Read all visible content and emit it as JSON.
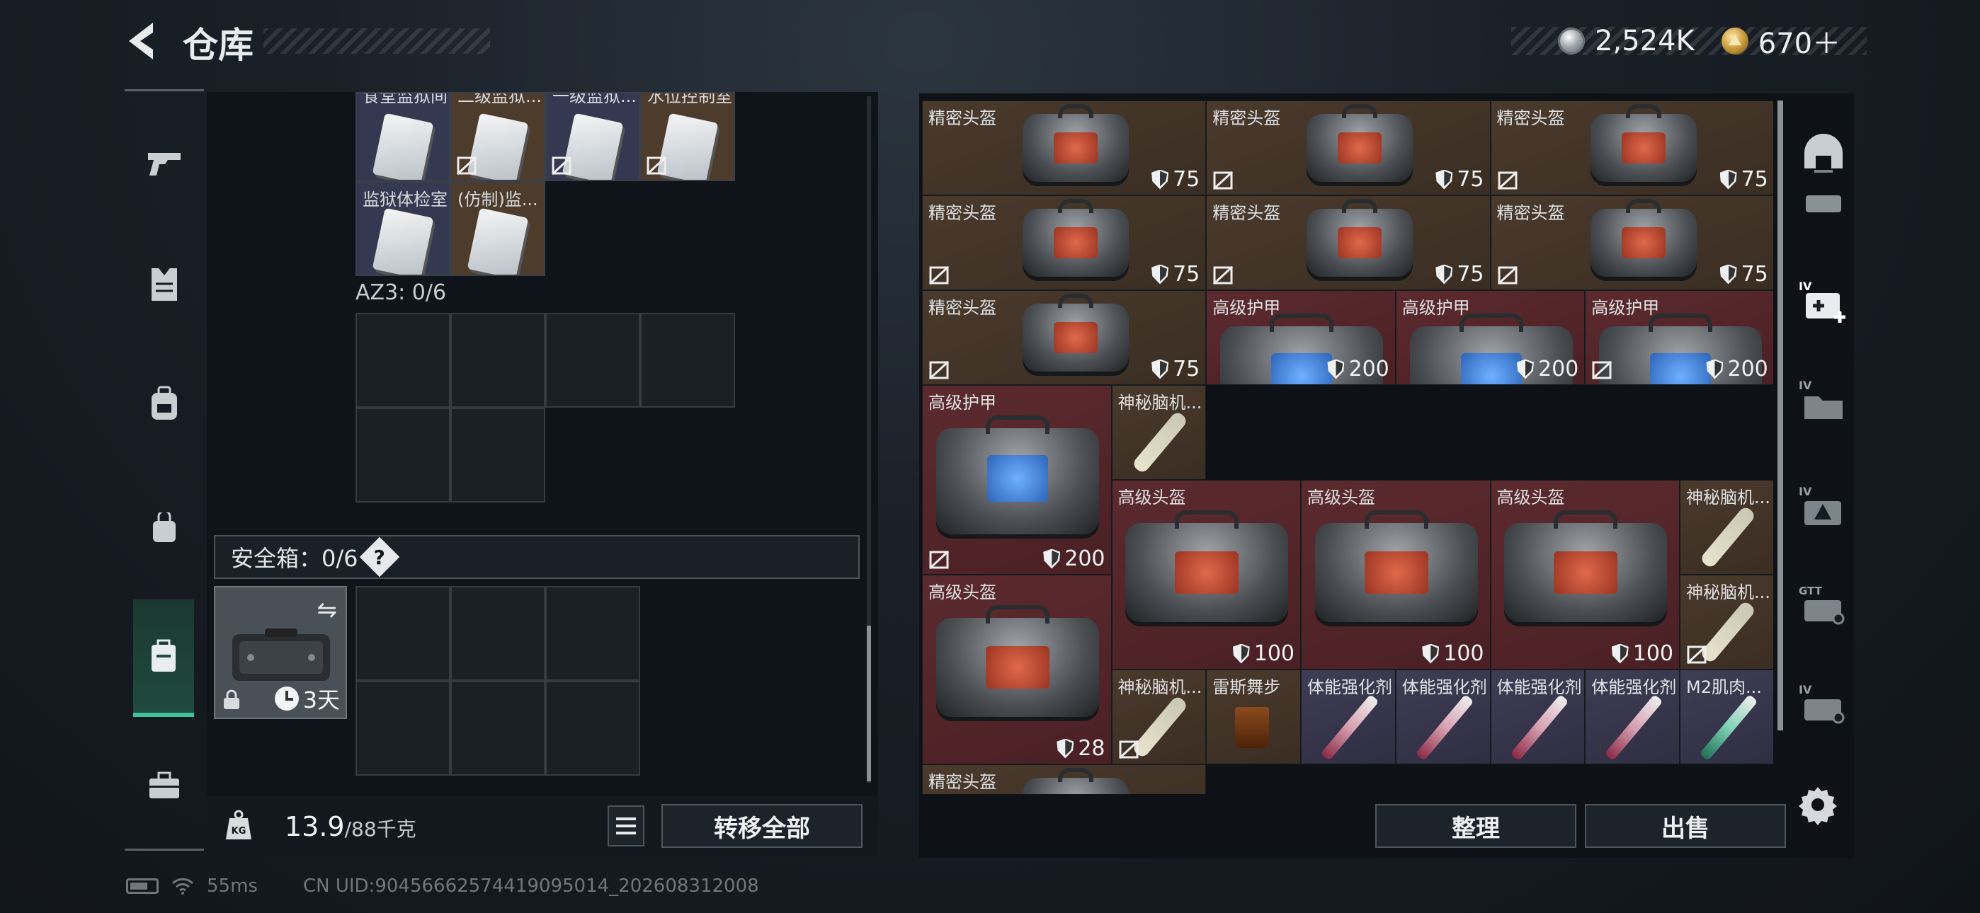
{
  "header": {
    "title": "仓库",
    "currency_silver": "2,524K",
    "currency_gold": "670＋"
  },
  "sidebar": {
    "items": [
      "weapons",
      "armor",
      "backpack",
      "bag",
      "safebox",
      "briefcase"
    ],
    "active": "safebox"
  },
  "storage": {
    "cut_labels": [
      "食堂监狱间",
      "二级监狱...",
      "一级监狱...",
      "水位控制室"
    ],
    "keycards_row2": [
      "监狱体检室",
      "(仿制)监..."
    ],
    "az3_label": "AZ3: 0/6",
    "safebox_label": "安全箱：0/6",
    "safebox_help": "?",
    "safebox_timer": "3天",
    "weight_value": "13.9",
    "weight_unit": "/88千克",
    "transfer_all": "转移全部"
  },
  "inventory": {
    "items": [
      {
        "name": "精密头盔",
        "value": "75"
      },
      {
        "name": "精密头盔",
        "value": "75"
      },
      {
        "name": "精密头盔",
        "value": "75"
      },
      {
        "name": "精密头盔",
        "value": "75"
      },
      {
        "name": "精密头盔",
        "value": "75"
      },
      {
        "name": "精密头盔",
        "value": "75"
      },
      {
        "name": "精密头盔",
        "value": "75"
      },
      {
        "name": "高级护甲",
        "value": "200"
      },
      {
        "name": "高级护甲",
        "value": "200"
      },
      {
        "name": "高级护甲",
        "value": "200"
      },
      {
        "name": "高级护甲",
        "value": "200"
      },
      {
        "name": "神秘脑机...",
        "value": ""
      },
      {
        "name": "高级头盔",
        "value": "100"
      },
      {
        "name": "高级头盔",
        "value": "100"
      },
      {
        "name": "高级头盔",
        "value": "100"
      },
      {
        "name": "神秘脑机...",
        "value": ""
      },
      {
        "name": "高级头盔",
        "value": "28"
      },
      {
        "name": "神秘脑机...",
        "value": ""
      },
      {
        "name": "神秘脑机...",
        "value": ""
      },
      {
        "name": "雷斯舞步",
        "value": ""
      },
      {
        "name": "体能强化剂",
        "value": ""
      },
      {
        "name": "体能强化剂",
        "value": ""
      },
      {
        "name": "体能强化剂",
        "value": ""
      },
      {
        "name": "体能强化剂",
        "value": ""
      },
      {
        "name": "M2肌肉...",
        "value": ""
      },
      {
        "name": "精密头盔",
        "value": ""
      }
    ],
    "sort_label": "整理",
    "sell_label": "出售"
  },
  "status": {
    "ping": "55ms",
    "uid": "CN UID:9045666257441909501​4_202608312008"
  },
  "colors": {
    "accent": "#3fc29c",
    "brown_cell": "#443529",
    "red_cell": "#552629",
    "purple_cell": "#37364c"
  }
}
